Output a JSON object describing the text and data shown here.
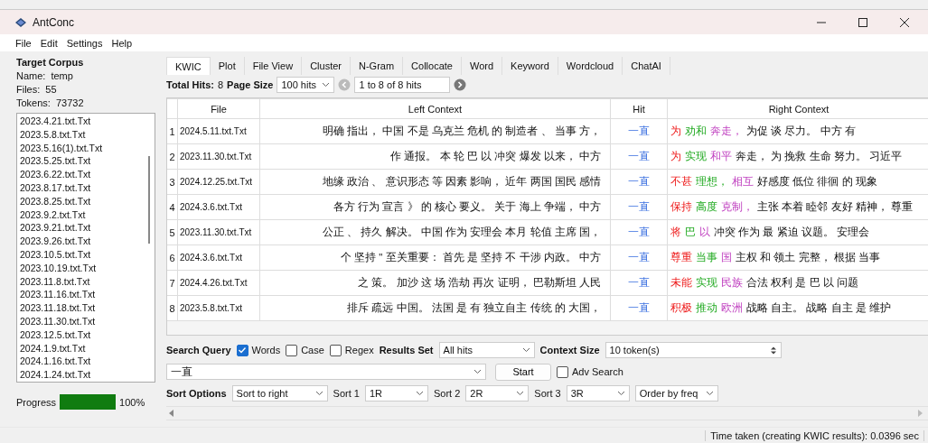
{
  "window": {
    "title": "AntConc"
  },
  "menu": [
    "File",
    "Edit",
    "Settings",
    "Help"
  ],
  "corpus": {
    "heading": "Target Corpus",
    "name_label": "Name:",
    "name": "temp",
    "files_label": "Files:",
    "files": "55",
    "tokens_label": "Tokens:",
    "tokens": "73732",
    "files_list": [
      "2023.4.21.txt.Txt",
      "2023.5.8.txt.Txt",
      "2023.5.16(1).txt.Txt",
      "2023.5.25.txt.Txt",
      "2023.6.22.txt.Txt",
      "2023.8.17.txt.Txt",
      "2023.8.25.txt.Txt",
      "2023.9.2.txt.Txt",
      "2023.9.21.txt.Txt",
      "2023.9.26.txt.Txt",
      "2023.10.5.txt.Txt",
      "2023.10.19.txt.Txt",
      "2023.11.8.txt.Txt",
      "2023.11.16.txt.Txt",
      "2023.11.18.txt.Txt",
      "2023.11.30.txt.Txt",
      "2023.12.5.txt.Txt",
      "2024.1.9.txt.Txt",
      "2024.1.16.txt.Txt",
      "2024.1.24.txt.Txt"
    ],
    "progress_label": "Progress",
    "progress": {
      "level": 1
    },
    "progress_reading": "100%"
  },
  "tabs": [
    {
      "label": "KWIC",
      "selected": true
    },
    {
      "label": "Plot",
      "selected": false
    },
    {
      "label": "File View",
      "selected": false
    },
    {
      "label": "Cluster",
      "selected": false
    },
    {
      "label": "N-Gram",
      "selected": false
    },
    {
      "label": "Collocate",
      "selected": false
    },
    {
      "label": "Word",
      "selected": false
    },
    {
      "label": "Keyword",
      "selected": false
    },
    {
      "label": "Wordcloud",
      "selected": false
    },
    {
      "label": "ChatAI",
      "selected": false
    }
  ],
  "hits_bar": {
    "total_label": "Total Hits:",
    "total": "8",
    "page_size_label": "Page Size",
    "page_size": "100 hits",
    "range": "1 to 8 of 8 hits"
  },
  "table": {
    "columns": [
      "File",
      "Left Context",
      "Hit",
      "Right Context"
    ],
    "rows": [
      {
        "num": "1",
        "file": "2024.5.11.txt.Txt",
        "left": "明确 指出， 中国 不是 乌克兰 危机 的 制造者 、 当事 方，",
        "hit": "一直",
        "right": [
          {
            "text": "为",
            "kind": "r1"
          },
          {
            "text": "劝和",
            "kind": "r2"
          },
          {
            "text": "奔走，",
            "kind": "r3"
          },
          {
            "text": "为促 谈 尽力。 中方 有",
            "kind": "plain"
          }
        ]
      },
      {
        "num": "2",
        "file": "2023.11.30.txt.Txt",
        "left": "作 通报。 本 轮 巴 以 冲突 爆发 以来， 中方",
        "hit": "一直",
        "right": [
          {
            "text": "为",
            "kind": "r1"
          },
          {
            "text": "实现",
            "kind": "r2"
          },
          {
            "text": "和平",
            "kind": "r3"
          },
          {
            "text": "奔走， 为 挽救 生命 努力。 习近平",
            "kind": "plain"
          }
        ]
      },
      {
        "num": "3",
        "file": "2024.12.25.txt.Txt",
        "left": "地缘 政治 、 意识形态 等 因素 影响， 近年 两国 国民 感情",
        "hit": "一直",
        "right": [
          {
            "text": "不甚",
            "kind": "r1"
          },
          {
            "text": "理想，",
            "kind": "r2"
          },
          {
            "text": "相互",
            "kind": "r3"
          },
          {
            "text": "好感度 低位 徘徊 的 现象",
            "kind": "plain"
          }
        ]
      },
      {
        "num": "4",
        "file": "2024.3.6.txt.Txt",
        "left": "各方 行为 宣言 》 的 核心 要义。 关于 海上 争端， 中方",
        "hit": "一直",
        "right": [
          {
            "text": "保持",
            "kind": "r1"
          },
          {
            "text": "高度",
            "kind": "r2"
          },
          {
            "text": "克制，",
            "kind": "r3"
          },
          {
            "text": "主张 本着 睦邻 友好 精神， 尊重",
            "kind": "plain"
          }
        ]
      },
      {
        "num": "5",
        "file": "2023.11.30.txt.Txt",
        "left": "公正 、 持久 解决。 中国 作为 安理会 本月 轮值 主席 国，",
        "hit": "一直",
        "right": [
          {
            "text": "将",
            "kind": "r1"
          },
          {
            "text": "巴",
            "kind": "r2"
          },
          {
            "text": "以",
            "kind": "r3"
          },
          {
            "text": "冲突 作为 最 紧迫 议题。 安理会",
            "kind": "plain"
          }
        ]
      },
      {
        "num": "6",
        "file": "2024.3.6.txt.Txt",
        "left": "个 坚持 \" 至关重要： 首先 是 坚持 不 干涉 内政。 中方",
        "hit": "一直",
        "right": [
          {
            "text": "尊重",
            "kind": "r1"
          },
          {
            "text": "当事",
            "kind": "r2"
          },
          {
            "text": "国",
            "kind": "r3"
          },
          {
            "text": "主权 和 领土 完整， 根据 当事",
            "kind": "plain"
          }
        ]
      },
      {
        "num": "7",
        "file": "2024.4.26.txt.Txt",
        "left": "之 策。 加沙 这 场 浩劫 再次 证明， 巴勒斯坦 人民",
        "hit": "一直",
        "right": [
          {
            "text": "未能",
            "kind": "r1"
          },
          {
            "text": "实现",
            "kind": "r2"
          },
          {
            "text": "民族",
            "kind": "r3"
          },
          {
            "text": "合法 权利 是 巴 以 问题",
            "kind": "plain"
          }
        ]
      },
      {
        "num": "8",
        "file": "2023.5.8.txt.Txt",
        "left": "排斥 疏远 中国。 法国 是 有 独立自主 传统 的 大国，",
        "hit": "一直",
        "right": [
          {
            "text": "积极",
            "kind": "r1"
          },
          {
            "text": "推动",
            "kind": "r2"
          },
          {
            "text": "欧洲",
            "kind": "r3"
          },
          {
            "text": "战略 自主。 战略 自主 是 维护",
            "kind": "plain"
          }
        ]
      }
    ]
  },
  "search": {
    "label": "Search Query",
    "options": [
      {
        "label": "Words",
        "checked": true
      },
      {
        "label": "Case",
        "checked": false
      },
      {
        "label": "Regex",
        "checked": false
      }
    ],
    "results_label": "Results Set",
    "results": "All hits",
    "context_label": "Context Size",
    "context": "10 token(s)",
    "query": "一直",
    "start": "Start",
    "adv": {
      "label": "Adv Search",
      "checked": false
    }
  },
  "sort": {
    "label": "Sort Options",
    "mode": "Sort to right",
    "levels": [
      {
        "label": "Sort 1",
        "value": "1R"
      },
      {
        "label": "Sort 2",
        "value": "2R"
      },
      {
        "label": "Sort 3",
        "value": "3R"
      }
    ],
    "order": "Order by freq"
  },
  "status_bar": "Time taken (creating KWIC results):  0.0396 sec"
}
